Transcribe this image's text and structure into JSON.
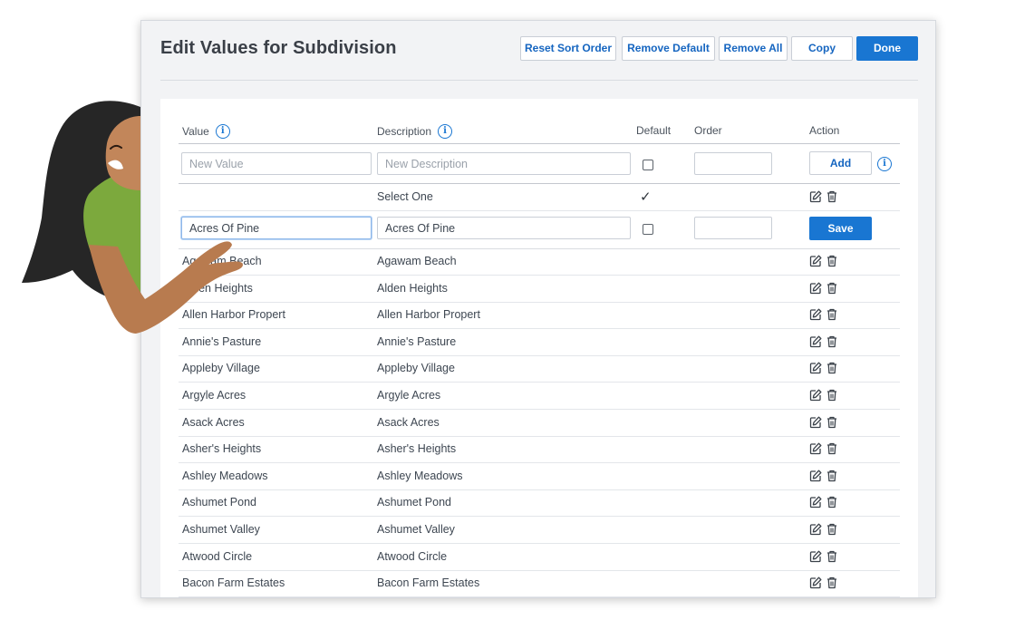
{
  "dialog": {
    "title": "Edit Values for Subdivision",
    "buttons": {
      "reset_sort": "Reset Sort Order",
      "remove_default": "Remove Default",
      "remove_all": "Remove All",
      "copy": "Copy",
      "done": "Done"
    }
  },
  "table": {
    "columns": {
      "value": "Value",
      "description": "Description",
      "default": "Default",
      "order": "Order",
      "action": "Action"
    },
    "new_row": {
      "value_placeholder": "New Value",
      "description_placeholder": "New Description",
      "add_label": "Add"
    },
    "select_one_row": {
      "description": "Select One",
      "default_mark": "✓"
    },
    "editing_row": {
      "value": "Acres Of Pine",
      "description": "Acres Of Pine",
      "save_label": "Save"
    },
    "rows": [
      {
        "value": "Agawam Beach",
        "description": "Agawam Beach"
      },
      {
        "value": "Alden Heights",
        "description": "Alden Heights"
      },
      {
        "value": "Allen Harbor Propert",
        "description": "Allen Harbor Propert"
      },
      {
        "value": "Annie's Pasture",
        "description": "Annie's Pasture"
      },
      {
        "value": "Appleby Village",
        "description": "Appleby Village"
      },
      {
        "value": "Argyle Acres",
        "description": "Argyle Acres"
      },
      {
        "value": "Asack Acres",
        "description": "Asack Acres"
      },
      {
        "value": "Asher's Heights",
        "description": "Asher's Heights"
      },
      {
        "value": "Ashley Meadows",
        "description": "Ashley Meadows"
      },
      {
        "value": "Ashumet Pond",
        "description": "Ashumet Pond"
      },
      {
        "value": "Ashumet Valley",
        "description": "Ashumet Valley"
      },
      {
        "value": "Atwood Circle",
        "description": "Atwood Circle"
      },
      {
        "value": "Bacon Farm Estates",
        "description": "Bacon Farm Estates"
      }
    ]
  },
  "icons": {
    "info": "info-icon",
    "edit": "edit-icon",
    "delete": "trash-icon"
  },
  "colors": {
    "accent": "#1976d2",
    "link_text": "#1565c0"
  }
}
